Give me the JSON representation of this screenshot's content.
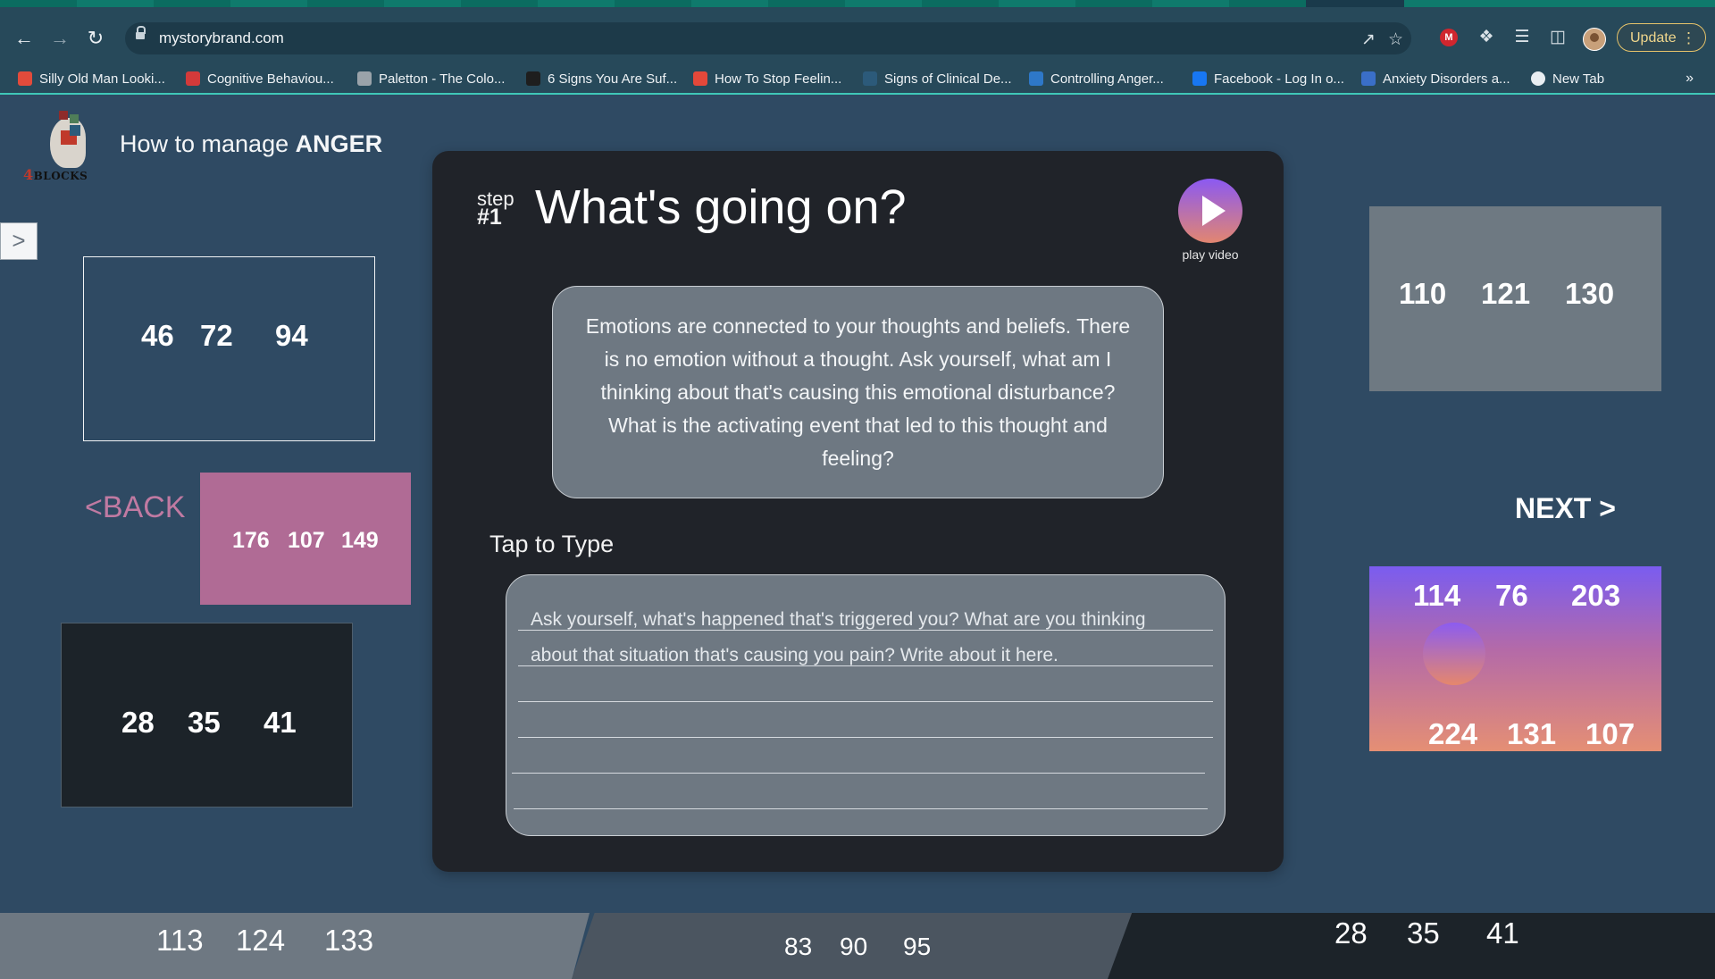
{
  "browser": {
    "url": "mystorybrand.com",
    "update_label": "Update",
    "bookmarks": [
      {
        "label": "Silly Old Man Looki...",
        "color": "#e24b3b"
      },
      {
        "label": "Cognitive Behaviou...",
        "color": "#d33a3a"
      },
      {
        "label": "Paletton - The Colo...",
        "color": "#9aa3aa"
      },
      {
        "label": "6 Signs You Are Suf...",
        "color": "#1e1e1e"
      },
      {
        "label": "How To Stop Feelin...",
        "color": "#e4483a"
      },
      {
        "label": "Signs of Clinical De...",
        "color": "#2c5a7a"
      },
      {
        "label": "Controlling Anger...",
        "color": "#2e78c8"
      },
      {
        "label": "Facebook - Log In o...",
        "color": "#1877f2"
      },
      {
        "label": "Anxiety Disorders a...",
        "color": "#3a6fc8"
      },
      {
        "label": "New Tab",
        "color": "#e9eef2"
      }
    ],
    "more_label": "»"
  },
  "header": {
    "logo_brand": "BLOCKS",
    "logo_brand_prefix": "4",
    "title_prefix": "How to manage ",
    "title_emphasis": "ANGER"
  },
  "nav": {
    "back_label": "<BACK",
    "next_label": "NEXT >",
    "drawer_label": ">"
  },
  "swatches": {
    "top_left": [
      "46",
      "72",
      "94"
    ],
    "back": [
      "176",
      "107",
      "149"
    ],
    "bottom_left": [
      "28",
      "35",
      "41"
    ],
    "top_right": [
      "110",
      "121",
      "130"
    ],
    "next_top": [
      "114",
      "76",
      "203"
    ],
    "next_bottom": [
      "224",
      "131",
      "107"
    ]
  },
  "card": {
    "step_label": "step",
    "step_number": "#1",
    "title": "What's going on?",
    "play_label": "play video",
    "info_text": "Emotions are connected to your thoughts and beliefs. There is no emotion without a thought. Ask yourself, what am I thinking about that's causing this emotional disturbance? What is the activating event that led to this thought and feeling?",
    "tap_label": "Tap to Type",
    "input_placeholder": "Ask yourself, what's happened that's triggered you? What are you thinking about that situation that's causing you pain? Write about it here."
  },
  "bottom_strip": {
    "left": [
      "113",
      "124",
      "133"
    ],
    "middle": [
      "83",
      "90",
      "95"
    ],
    "right": [
      "28",
      "35",
      "41"
    ]
  },
  "colors": {
    "page_bg": "#2f4a63",
    "card_bg": "#202329",
    "pink": "#b06b95",
    "accent_start": "#7a5cf0",
    "accent_end": "#e58f74"
  }
}
